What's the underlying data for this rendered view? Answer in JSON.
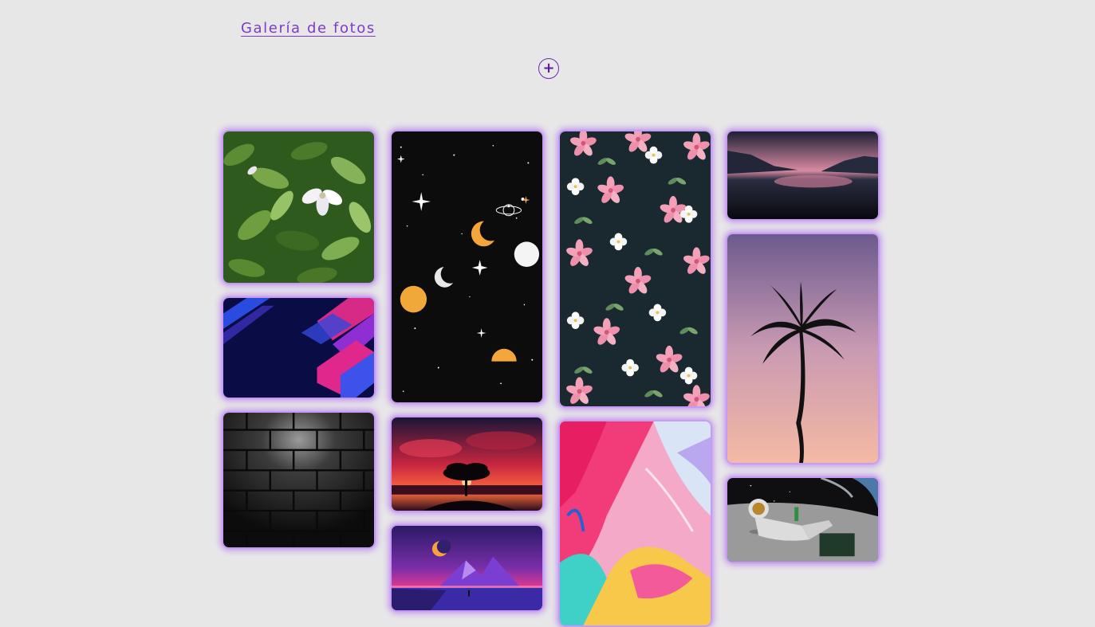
{
  "header": {
    "title": "Galería de fotos",
    "add_label": "+"
  },
  "gallery": {
    "photos": [
      {
        "name": "white-flower-leaves",
        "colors": [
          "#2f5a1e",
          "#6e9a43",
          "#ffffff"
        ]
      },
      {
        "name": "blue-pink-geometric",
        "colors": [
          "#0b0d4d",
          "#e0288c",
          "#2a3fd1"
        ]
      },
      {
        "name": "dark-brick-wall",
        "colors": [
          "#141414",
          "#3a3a3a",
          "#6a6a6a"
        ]
      },
      {
        "name": "space-moons-stars",
        "colors": [
          "#0d0d0d",
          "#f3a63a",
          "#ffffff"
        ]
      },
      {
        "name": "tree-red-sunset",
        "colors": [
          "#1c1436",
          "#e2364a",
          "#ffb347"
        ]
      },
      {
        "name": "synthwave-mountains",
        "colors": [
          "#3a1a6e",
          "#ff3d8b",
          "#f7a23d"
        ]
      },
      {
        "name": "pink-floral-pattern",
        "colors": [
          "#1a2a33",
          "#f2a1b8",
          "#ffffff"
        ]
      },
      {
        "name": "colorful-fluid-art",
        "colors": [
          "#f23c7a",
          "#3fd1c7",
          "#f7c84a"
        ]
      },
      {
        "name": "mountain-lake-dusk",
        "colors": [
          "#1a1d2e",
          "#d98aa2",
          "#3a3f56"
        ]
      },
      {
        "name": "palm-tree-pink-sky",
        "colors": [
          "#7a6296",
          "#f0b7a8",
          "#111111"
        ]
      },
      {
        "name": "astronaut-on-moon",
        "colors": [
          "#151515",
          "#a9a9a9",
          "#4b7aa8"
        ]
      }
    ]
  }
}
